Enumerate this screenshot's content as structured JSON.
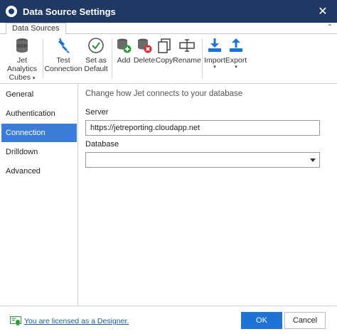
{
  "window": {
    "title": "Data Source Settings"
  },
  "tabs": [
    {
      "label": "Data Sources",
      "active": true
    }
  ],
  "ribbon": {
    "buttons": [
      {
        "label_line1": "Jet Analytics",
        "label_line2": "Cubes",
        "has_dropdown": true,
        "icon": "database-stack-icon"
      },
      {
        "label_line1": "Test",
        "label_line2": "Connection",
        "icon": "plug-icon"
      },
      {
        "label_line1": "Set as",
        "label_line2": "Default",
        "icon": "checkmark-circle-icon"
      },
      {
        "label_line1": "Add",
        "icon": "add-database-icon"
      },
      {
        "label_line1": "Delete",
        "icon": "delete-database-icon"
      },
      {
        "label_line1": "Copy",
        "icon": "copy-icon"
      },
      {
        "label_line1": "Rename",
        "icon": "rename-icon"
      },
      {
        "label_line1": "Import",
        "has_dropdown": true,
        "icon": "import-icon"
      },
      {
        "label_line1": "Export",
        "has_dropdown": true,
        "icon": "export-icon"
      }
    ]
  },
  "sidebar": {
    "items": [
      {
        "label": "General"
      },
      {
        "label": "Authentication"
      },
      {
        "label": "Connection",
        "active": true
      },
      {
        "label": "Drilldown"
      },
      {
        "label": "Advanced"
      }
    ]
  },
  "main": {
    "heading": "Change how Jet connects to your database",
    "server": {
      "label": "Server",
      "value": "https://jetreporting.cloudapp.net"
    },
    "database": {
      "label": "Database",
      "value": ""
    }
  },
  "footer": {
    "license_text": "You are licensed as a Designer.",
    "ok_label": "OK",
    "cancel_label": "Cancel"
  },
  "colors": {
    "titlebar": "#1f3864",
    "accent": "#3b7dd8",
    "ok_button": "#1e73d6"
  }
}
